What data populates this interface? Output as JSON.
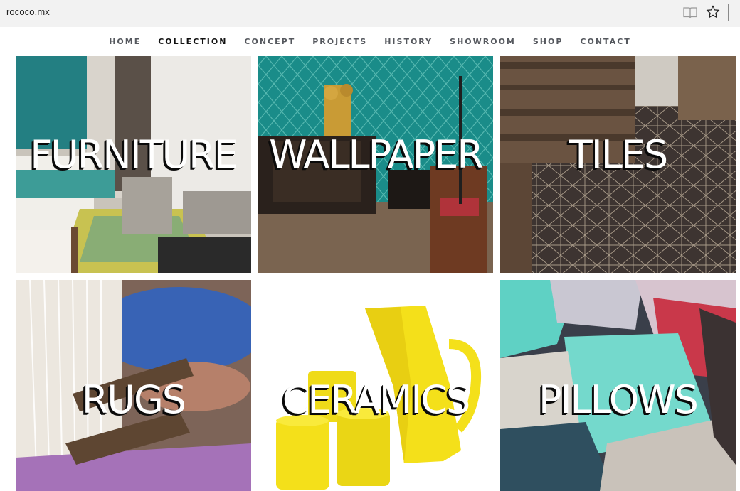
{
  "browser": {
    "url": "rococo.mx",
    "icons": [
      "reading-view-icon",
      "favorite-star-icon"
    ]
  },
  "nav": {
    "items": [
      {
        "label": "HOME"
      },
      {
        "label": "COLLECTION",
        "active": true
      },
      {
        "label": "CONCEPT"
      },
      {
        "label": "PROJECTS"
      },
      {
        "label": "HISTORY"
      },
      {
        "label": "SHOWROOM"
      },
      {
        "label": "SHOP"
      },
      {
        "label": "CONTACT"
      }
    ]
  },
  "tiles": [
    {
      "label": "FURNITURE"
    },
    {
      "label": "WALLPAPER"
    },
    {
      "label": "TILES"
    },
    {
      "label": "RUGS"
    },
    {
      "label": "CERAMICS"
    },
    {
      "label": "PILLOWS"
    }
  ],
  "colors": {
    "teal": "#1f8c8a",
    "ceramic_yellow": "#f5e11a",
    "rug_purple": "#a572b8",
    "pillow_mint": "#5fd1c4"
  }
}
